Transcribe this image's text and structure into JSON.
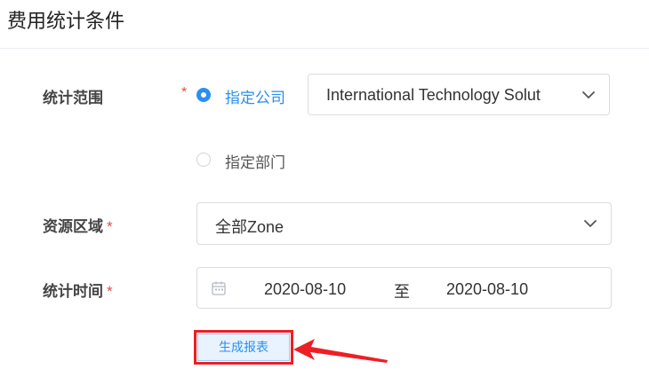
{
  "header": {
    "title": "费用统计条件"
  },
  "form": {
    "scope": {
      "label": "统计范围",
      "required_mark": "*",
      "options": [
        {
          "label": "指定公司",
          "checked": true
        },
        {
          "label": "指定部门",
          "checked": false
        }
      ],
      "company_select": {
        "value": "International Technology Solut"
      }
    },
    "region": {
      "label": "资源区域",
      "required_mark": "*",
      "select": {
        "value": "全部Zone"
      }
    },
    "time": {
      "label": "统计时间",
      "required_mark": "*",
      "start_date": "2020-08-10",
      "separator": "至",
      "end_date": "2020-08-10"
    },
    "generate_button": {
      "label": "生成报表"
    }
  },
  "colors": {
    "accent": "#2a8ff0",
    "required": "#e84a4a",
    "annotation": "#ee1f24"
  },
  "icons": {
    "chevron": "chevron-down-icon",
    "calendar": "calendar-icon",
    "arrow": "annotation-arrow-icon"
  }
}
